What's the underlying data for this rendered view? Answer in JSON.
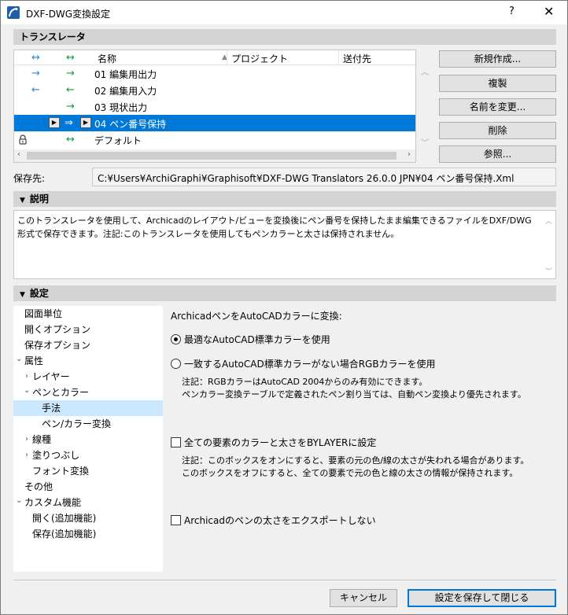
{
  "window": {
    "title": "DXF-DWG変換設定",
    "help": "?",
    "close": "✕"
  },
  "translators": {
    "header": "トランスレータ",
    "columns": {
      "name": "名称",
      "project": "プロジェクト",
      "send_to": "送付先"
    },
    "rows": [
      {
        "name": "01 編集用出力",
        "in_arrow": "→",
        "out_arrow": "→"
      },
      {
        "name": "02 編集用入力",
        "in_arrow": "←",
        "out_arrow": "←"
      },
      {
        "name": "03 現状出力",
        "in_arrow": "",
        "out_arrow": "→"
      },
      {
        "name": "04 ペン番号保持",
        "in_arrow": "",
        "out_arrow": "⇒",
        "selected": true
      },
      {
        "name": "デフォルト",
        "in_arrow": "",
        "out_arrow": "↔",
        "locked": true
      }
    ],
    "head_in_arrow": "↔",
    "head_out_arrow": "↔"
  },
  "buttons": {
    "new": "新規作成...",
    "duplicate": "複製",
    "rename": "名前を変更...",
    "delete": "削除",
    "browse": "参照...",
    "cancel": "キャンセル",
    "save_close": "設定を保存して閉じる"
  },
  "save_location": {
    "label": "保存先:",
    "path": "C:¥Users¥ArchiGraphi¥Graphisoft¥DXF-DWG Translators 26.0.0 JPN¥04 ペン番号保持.Xml"
  },
  "description": {
    "header": "説明",
    "text": "このトランスレータを使用して、Archicadのレイアウト/ビューを変換後にペン番号を保持したまま編集できるファイルをDXF/DWG形式で保存できます。注記:このトランスレータを使用してもペンカラーと太さは保持されません。"
  },
  "settings": {
    "header": "設定",
    "tree": [
      {
        "label": "図面単位",
        "indent": 0,
        "chev": ""
      },
      {
        "label": "開くオプション",
        "indent": 0,
        "chev": ""
      },
      {
        "label": "保存オプション",
        "indent": 0,
        "chev": ""
      },
      {
        "label": "属性",
        "indent": 0,
        "chev": "⌄"
      },
      {
        "label": "レイヤー",
        "indent": 1,
        "chev": "›"
      },
      {
        "label": "ペンとカラー",
        "indent": 1,
        "chev": "⌄"
      },
      {
        "label": "手法",
        "indent": 2,
        "chev": "",
        "selected": true
      },
      {
        "label": "ペン/カラー変換",
        "indent": 2,
        "chev": ""
      },
      {
        "label": "線種",
        "indent": 1,
        "chev": "›"
      },
      {
        "label": "塗りつぶし",
        "indent": 1,
        "chev": "›"
      },
      {
        "label": "フォント変換",
        "indent": 1,
        "chev": ""
      },
      {
        "label": "その他",
        "indent": 0,
        "chev": ""
      },
      {
        "label": "カスタム機能",
        "indent": 0,
        "chev": "⌄"
      },
      {
        "label": "開く(追加機能)",
        "indent": 1,
        "chev": ""
      },
      {
        "label": "保存(追加機能)",
        "indent": 1,
        "chev": ""
      }
    ],
    "method": {
      "title": "ArchicadペンをAutoCADカラーに変換:",
      "radio_best": "最適なAutoCAD標準カラーを使用",
      "radio_rgb": "一致するAutoCAD標準カラーがない場合RGBカラーを使用",
      "note_rgb_1": "注記：RGBカラーはAutoCAD 2004からのみ有効にできます。",
      "note_rgb_2": "ペンカラー変換テーブルで定義されたペン割り当ては、自動ペン変換より優先されます。",
      "check_bylayer": "全ての要素のカラーと太さをBYLAYERに設定",
      "note_bylayer_1": "注記：このボックスをオンにすると、要素の元の色/線の太さが失われる場合があります。",
      "note_bylayer_2": "このボックスをオフにすると、全ての要素で元の色と線の太さの情報が保持されます。",
      "check_no_pen_weight": "Archicadのペンの太さをエクスポートしない"
    }
  }
}
